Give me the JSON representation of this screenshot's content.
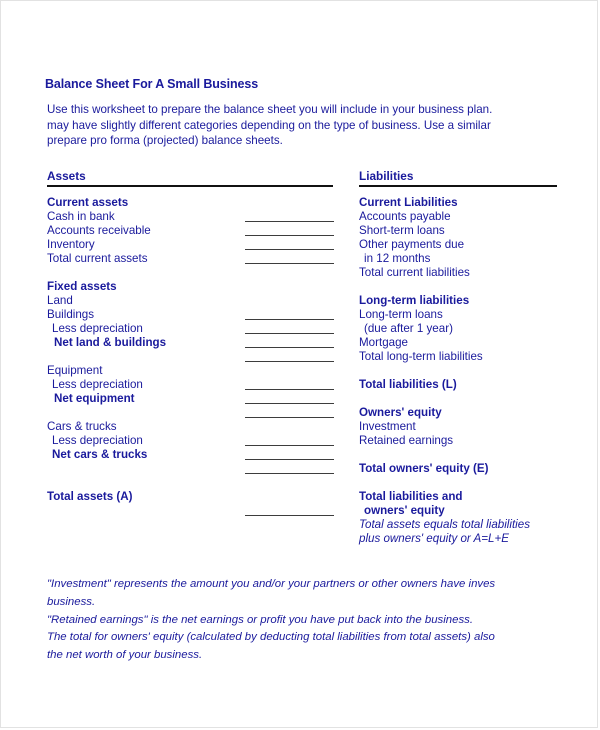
{
  "document": {
    "title": "Balance Sheet For A Small Business",
    "intro_lines": [
      "Use this worksheet to prepare the balance sheet you will include in your business plan. ",
      "may have slightly different categories depending on the type of business.  Use a similar ",
      "prepare pro forma (projected) balance sheets."
    ]
  },
  "assets": {
    "heading": "Assets",
    "rows": [
      {
        "label": "Current assets",
        "bold": true,
        "indent": 0,
        "fill": false
      },
      {
        "label": "Cash in bank",
        "bold": false,
        "indent": 0,
        "fill": true
      },
      {
        "label": "Accounts receivable",
        "bold": false,
        "indent": 0,
        "fill": true
      },
      {
        "label": "Inventory",
        "bold": false,
        "indent": 0,
        "fill": true
      },
      {
        "label": "Total current assets",
        "bold": false,
        "indent": 0,
        "fill": true
      },
      {
        "label": "",
        "bold": false,
        "indent": 0,
        "fill": false
      },
      {
        "label": "Fixed assets",
        "bold": true,
        "indent": 0,
        "fill": false
      },
      {
        "label": "Land",
        "bold": false,
        "indent": 0,
        "fill": false
      },
      {
        "label": "Buildings",
        "bold": false,
        "indent": 0,
        "fill": true
      },
      {
        "label": "Less depreciation",
        "bold": false,
        "indent": 1,
        "fill": true
      },
      {
        "label": "Net land & buildings",
        "bold": true,
        "indent": 2,
        "fill": true
      },
      {
        "label": "",
        "bold": false,
        "indent": 0,
        "fill": true
      },
      {
        "label": "Equipment",
        "bold": false,
        "indent": 0,
        "fill": false
      },
      {
        "label": "Less depreciation",
        "bold": false,
        "indent": 1,
        "fill": true
      },
      {
        "label": "Net equipment",
        "bold": true,
        "indent": 2,
        "fill": true
      },
      {
        "label": "",
        "bold": false,
        "indent": 0,
        "fill": true
      },
      {
        "label": "Cars & trucks",
        "bold": false,
        "indent": 0,
        "fill": false
      },
      {
        "label": "Less depreciation",
        "bold": false,
        "indent": 1,
        "fill": true
      },
      {
        "label": "Net cars & trucks",
        "bold": true,
        "indent": 1,
        "fill": true
      },
      {
        "label": "",
        "bold": false,
        "indent": 0,
        "fill": true
      },
      {
        "label": "",
        "bold": false,
        "indent": 0,
        "fill": false
      },
      {
        "label": "Total assets (A)",
        "bold": true,
        "indent": 0,
        "fill": false
      },
      {
        "label": "",
        "bold": false,
        "indent": 0,
        "fill": true
      }
    ]
  },
  "liabilities": {
    "heading": "Liabilities",
    "rows": [
      {
        "label": "Current Liabilities",
        "bold": true,
        "indent": 0,
        "italic": false
      },
      {
        "label": "Accounts payable",
        "bold": false,
        "indent": 0,
        "italic": false
      },
      {
        "label": "Short-term loans",
        "bold": false,
        "indent": 0,
        "italic": false
      },
      {
        "label": "Other payments due",
        "bold": false,
        "indent": 0,
        "italic": false
      },
      {
        "label": "in 12 months",
        "bold": false,
        "indent": 1,
        "italic": false
      },
      {
        "label": "Total current liabilities",
        "bold": false,
        "indent": 0,
        "italic": false
      },
      {
        "label": "",
        "bold": false,
        "indent": 0,
        "italic": false
      },
      {
        "label": "Long-term liabilities",
        "bold": true,
        "indent": 0,
        "italic": false
      },
      {
        "label": "Long-term loans",
        "bold": false,
        "indent": 0,
        "italic": false
      },
      {
        "label": "(due after 1 year)",
        "bold": false,
        "indent": 1,
        "italic": false
      },
      {
        "label": "Mortgage",
        "bold": false,
        "indent": 0,
        "italic": false
      },
      {
        "label": "Total long-term liabilities",
        "bold": false,
        "indent": 0,
        "italic": false
      },
      {
        "label": "",
        "bold": false,
        "indent": 0,
        "italic": false
      },
      {
        "label": "Total liabilities (L)",
        "bold": true,
        "indent": 0,
        "italic": false
      },
      {
        "label": "",
        "bold": false,
        "indent": 0,
        "italic": false
      },
      {
        "label": "Owners' equity",
        "bold": true,
        "indent": 0,
        "italic": false
      },
      {
        "label": "Investment",
        "bold": false,
        "indent": 0,
        "italic": false
      },
      {
        "label": "Retained earnings",
        "bold": false,
        "indent": 0,
        "italic": false
      },
      {
        "label": "",
        "bold": false,
        "indent": 0,
        "italic": false
      },
      {
        "label": "Total owners' equity (E)",
        "bold": true,
        "indent": 0,
        "italic": false
      },
      {
        "label": "",
        "bold": false,
        "indent": 0,
        "italic": false
      },
      {
        "label": "Total liabilities and",
        "bold": true,
        "indent": 0,
        "italic": false
      },
      {
        "label": "owners' equity",
        "bold": true,
        "indent": 1,
        "italic": false
      },
      {
        "label": "Total assets equals total liabilities",
        "bold": false,
        "indent": 0,
        "italic": true
      },
      {
        "label": "plus owners' equity or A=L+E",
        "bold": false,
        "indent": 0,
        "italic": true
      }
    ]
  },
  "notes": {
    "lines": [
      "\"Investment\" represents the amount you and/or your partners or other owners have inves",
      "business.",
      "\"Retained earnings\" is the net earnings or profit you have put back into the business.",
      "The total for owners' equity (calculated by deducting total liabilities from total assets) also",
      "the net worth of your business."
    ]
  },
  "colors": {
    "ink": "#1a1a9c",
    "rule": "#111111",
    "fill_rule": "#3d3d3d",
    "page": "#ffffff"
  }
}
